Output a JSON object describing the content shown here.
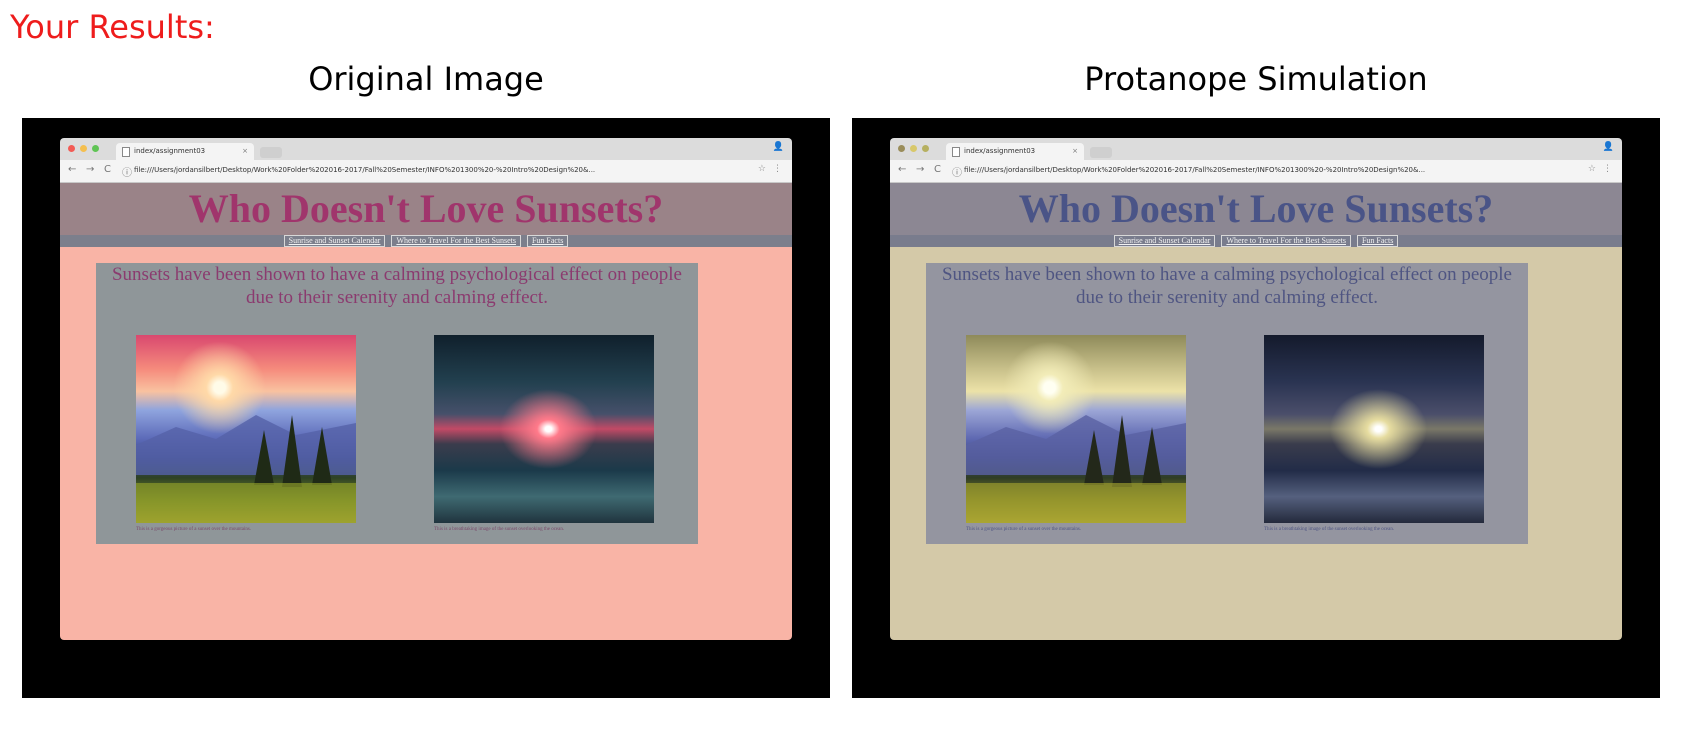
{
  "heading": "Your Results:",
  "colors": {
    "heading": "#ee1c1c",
    "original": {
      "background": "#f9b4a6",
      "header_band": "#9a8388",
      "nav_band": "#7c7f8c",
      "title": "#a0356c",
      "box": "#8f9699",
      "text": "#8b3b6f"
    },
    "simulation": {
      "background": "#d4c9a8",
      "header_band": "#8c8793",
      "nav_band": "#797c8d",
      "title": "#4a5487",
      "box": "#9495a0",
      "text": "#4f5582"
    }
  },
  "panels": [
    {
      "title": "Original Image",
      "browser": {
        "tab_title": "index/assignment03",
        "tab_close": "×",
        "url": "file:///Users/jordansilbert/Desktop/Work%20Folder%202016-2017/Fall%20Semester/INFO%201300%20-%20Intro%20Design%20&...",
        "site_title": "Who Doesn't Love Sunsets?",
        "nav": [
          "Sunrise and Sunset Calendar",
          "Where to Travel For the Best Sunsets",
          "Fun Facts"
        ],
        "blurb": "Sunsets have been shown to have a calming psychological effect on people due to their serenity and calming effect.",
        "captions": [
          "This is a gorgeous picture of a sunset over the mountains.",
          "This is a breathtaking image of the sunset overlooking the ocean."
        ]
      }
    },
    {
      "title": "Protanope Simulation",
      "browser": {
        "tab_title": "index/assignment03",
        "tab_close": "×",
        "url": "file:///Users/jordansilbert/Desktop/Work%20Folder%202016-2017/Fall%20Semester/INFO%201300%20-%20Intro%20Design%20&...",
        "site_title": "Who Doesn't Love Sunsets?",
        "nav": [
          "Sunrise and Sunset Calendar",
          "Where to Travel For the Best Sunsets",
          "Fun Facts"
        ],
        "blurb": "Sunsets have been shown to have a calming psychological effect on people due to their serenity and calming effect.",
        "captions": [
          "This is a gorgeous picture of a sunset over the mountains.",
          "This is a breathtaking image of the sunset overlooking the ocean."
        ]
      }
    }
  ],
  "icons": {
    "back": "←",
    "forward": "→",
    "reload": "C",
    "info": "ⓘ",
    "star": "☆",
    "menu": "⋮",
    "user": "👤"
  }
}
